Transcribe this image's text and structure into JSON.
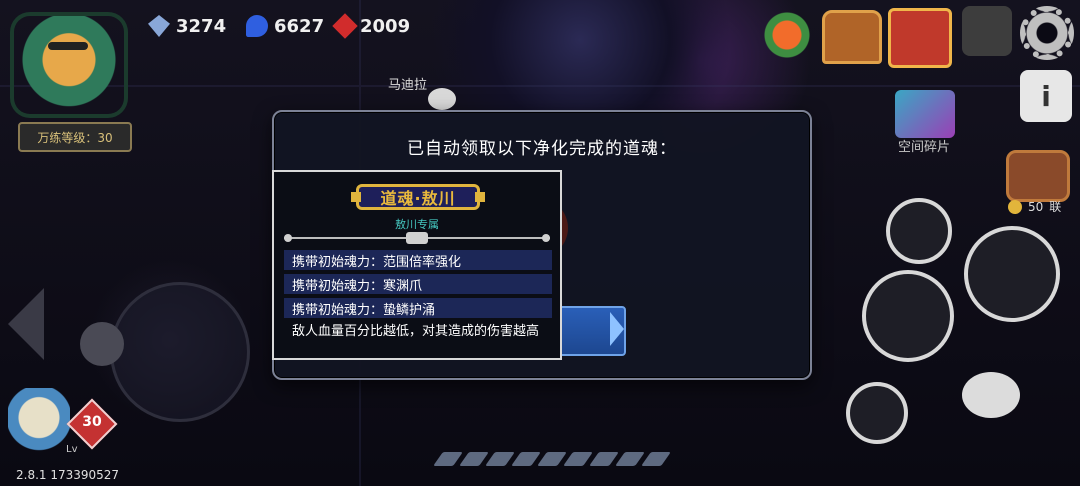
{
  "currencies": [
    {
      "icon": "gem-icon",
      "value": "3274"
    },
    {
      "icon": "sapphire-icon",
      "value": "6627"
    },
    {
      "icon": "ruby-icon",
      "value": "2009"
    }
  ],
  "player": {
    "level_label": "万练等级：30"
  },
  "npc": {
    "name": "马迪拉"
  },
  "hud": {
    "space_fragment_label": "空间碎片",
    "coin_value": "50",
    "coin_suffix": "联",
    "hero_level": "30",
    "lv_label": "Lv",
    "version": "2.8.1 173390527",
    "info_glyph": "i"
  },
  "dialog": {
    "title": "已自动领取以下净化完成的道魂："
  },
  "card": {
    "title": "道魂·敖川",
    "subtitle": "敖川专属",
    "attributes": [
      "携带初始魂力：范围倍率强化",
      "携带初始魂力：寒渊爪",
      "携带初始魂力：蛰鳞护涌"
    ],
    "description": "敌人血量百分比越低，对其造成的伤害越高"
  },
  "colors": {
    "card_title_gold": "#e9b93c",
    "subtitle_teal": "#45c7c0",
    "attr_row_blue": "#1c2757",
    "button_blue": "#2a5fb8"
  }
}
